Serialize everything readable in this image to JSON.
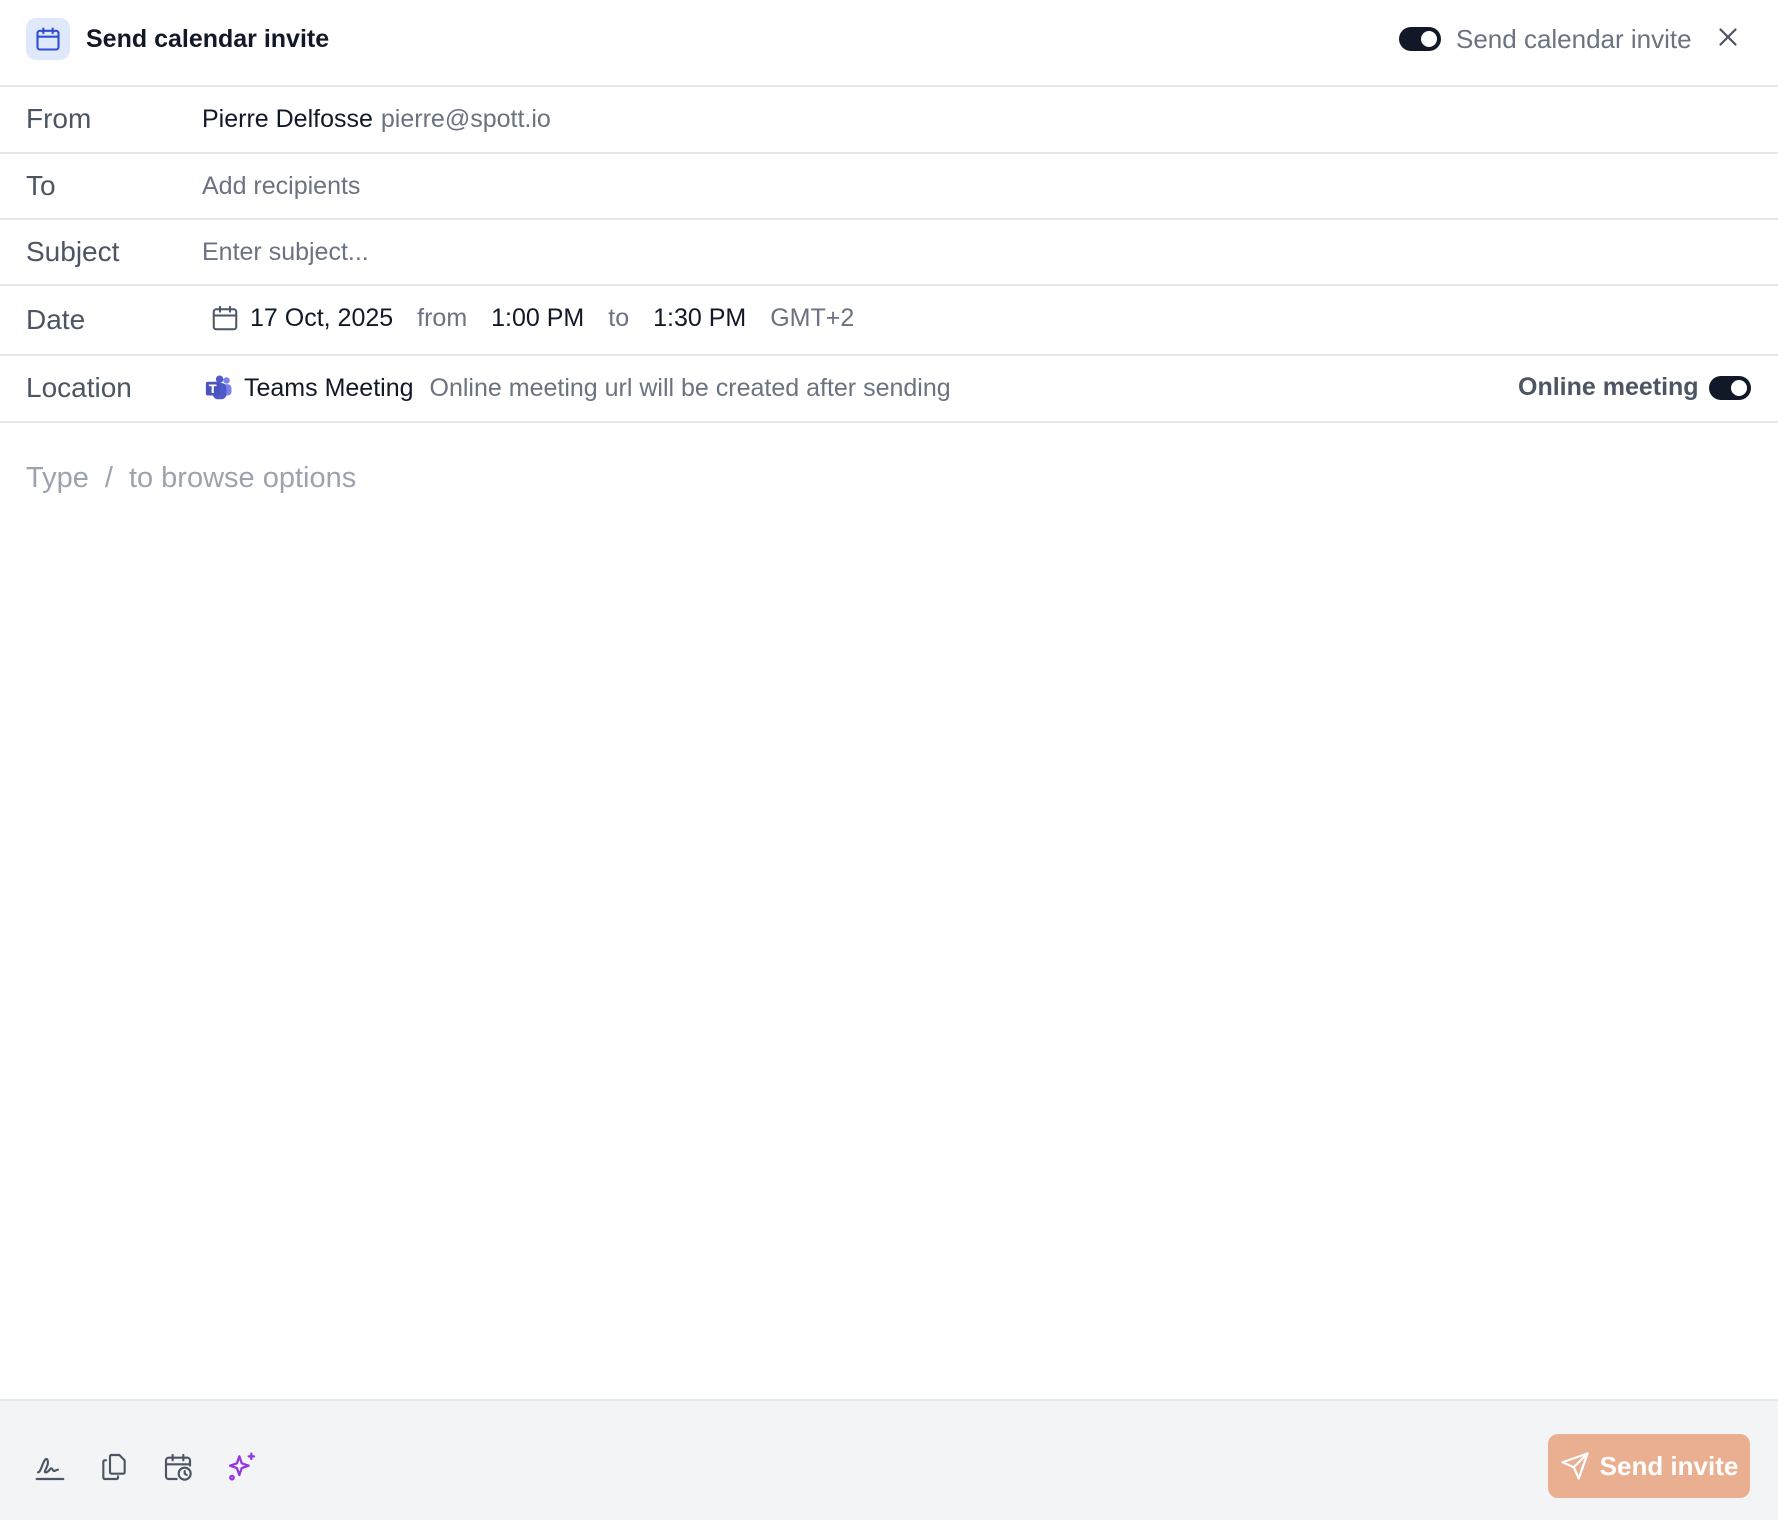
{
  "header": {
    "title": "Send calendar invite",
    "toggle_label": "Send calendar invite",
    "toggle_on": true,
    "icon": "calendar-icon"
  },
  "fields": {
    "from": {
      "label": "From",
      "name": "Pierre Delfosse",
      "email": "pierre@spott.io"
    },
    "to": {
      "label": "To",
      "placeholder": "Add recipients"
    },
    "subject": {
      "label": "Subject",
      "placeholder": "Enter subject..."
    },
    "date": {
      "label": "Date",
      "date": "17 Oct, 2025",
      "from_word": "from",
      "start": "1:00 PM",
      "to_word": "to",
      "end": "1:30 PM",
      "timezone": "GMT+2"
    },
    "location": {
      "label": "Location",
      "provider": "Teams Meeting",
      "note": "Online meeting url will be created after sending",
      "toggle_label": "Online meeting",
      "toggle_on": true
    }
  },
  "editor": {
    "type_word": "Type",
    "slash": "/",
    "hint": "to browse options"
  },
  "footer": {
    "tools": [
      "signature-icon",
      "copy-icon",
      "calendar-clock-icon",
      "sparkles-icon"
    ],
    "send_label": "Send invite"
  },
  "colors": {
    "accent_button": "#eaae91",
    "toggle": "#111827",
    "ai_purple": "#9333ea",
    "calendar_icon_blue": "#2f4fd1"
  }
}
